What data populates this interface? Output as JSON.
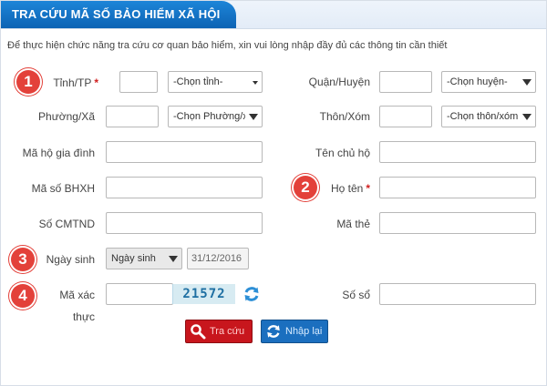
{
  "header": {
    "title": "TRA CỨU MÃ SỐ BẢO HIỂM XÃ HỘI"
  },
  "instruction": "Để thực hiện chức năng tra cứu cơ quan bảo hiểm, xin vui lòng nhập đầy đủ các thông tin cần thiết",
  "badges": [
    "1",
    "2",
    "3",
    "4"
  ],
  "required_marker": "*",
  "fields": {
    "tinh_tp": {
      "label": "Tỉnh/TP",
      "select_value": "-Chọn tỉnh-"
    },
    "quan_huyen": {
      "label": "Quận/Huyện",
      "select_value": "-Chọn huyện-"
    },
    "phuong_xa": {
      "label": "Phường/Xã",
      "select_value": "-Chọn Phường/xã"
    },
    "thon_xom": {
      "label": "Thôn/Xóm",
      "select_value": "-Chọn thôn/xóm"
    },
    "ma_ho_gia_dinh": {
      "label": "Mã hộ gia đình"
    },
    "ten_chu_ho": {
      "label": "Tên chủ hộ"
    },
    "ma_so_bhxh": {
      "label": "Mã số BHXH"
    },
    "ho_ten": {
      "label": "Họ tên"
    },
    "so_cmtnd": {
      "label": "Số CMTND"
    },
    "ma_the": {
      "label": "Mã thẻ"
    },
    "ngay_sinh": {
      "label": "Ngày sinh",
      "select_value": "Ngày sinh",
      "date_value": "31/12/2016"
    },
    "ma_xac_thuc": {
      "label": "Mã xác thực",
      "captcha": "21572"
    },
    "so_so": {
      "label": "Số sổ"
    }
  },
  "buttons": {
    "search": "Tra cứu",
    "reset": "Nhập lại"
  },
  "colors": {
    "header_blue": "#0d63b4",
    "badge_red": "#e3413a",
    "search_red": "#c8161d",
    "reset_blue": "#1b6fbf"
  }
}
